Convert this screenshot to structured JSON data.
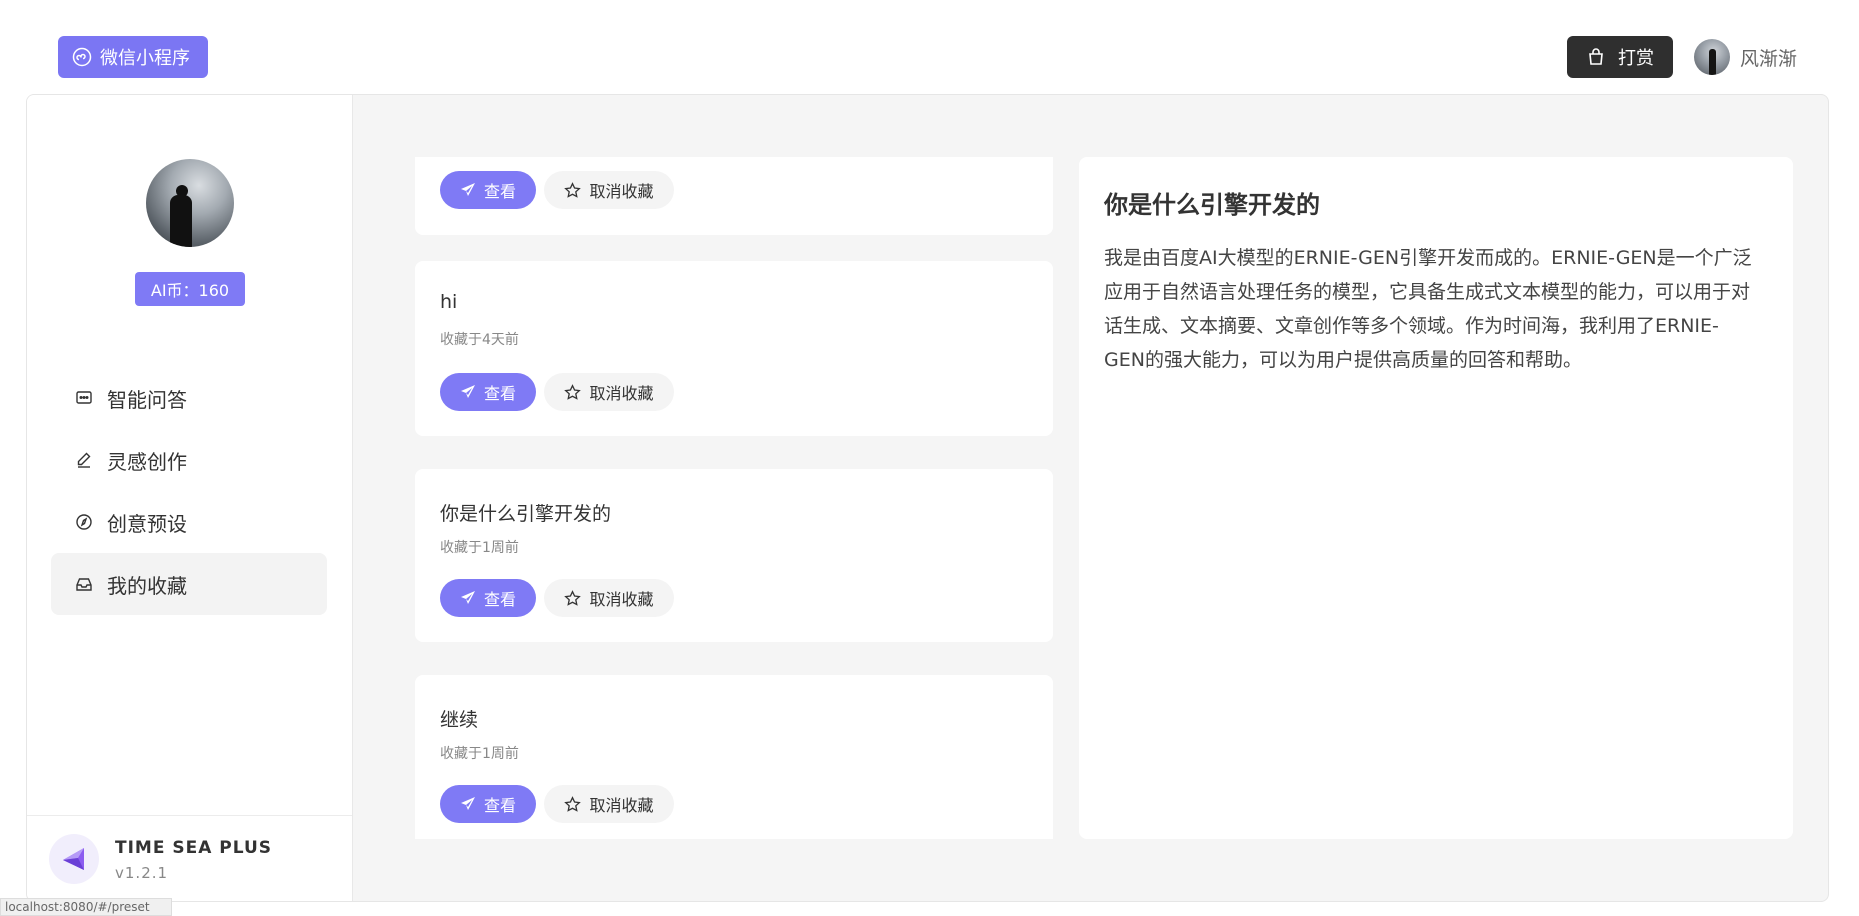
{
  "header": {
    "miniprogram_label": "微信小程序",
    "tip_label": "打赏",
    "username": "风渐渐"
  },
  "sidebar": {
    "coins": "AI币：160",
    "items": [
      {
        "label": "智能问答",
        "icon": "chat-icon"
      },
      {
        "label": "灵感创作",
        "icon": "pen-icon"
      },
      {
        "label": "创意预设",
        "icon": "compass-icon"
      },
      {
        "label": "我的收藏",
        "icon": "inbox-icon",
        "active": true
      }
    ],
    "brand": {
      "name": "TIME SEA PLUS",
      "version": "v1.2.1"
    }
  },
  "favorites": {
    "view_label": "查看",
    "unfav_label": "取消收藏",
    "items": [
      {
        "title": "hi",
        "time": "收藏于4天前"
      },
      {
        "title": "你是什么引擎开发的",
        "time": "收藏于1周前"
      },
      {
        "title": "继续",
        "time": "收藏于1周前"
      }
    ]
  },
  "detail": {
    "title": "你是什么引擎开发的",
    "body": "我是由百度AI大模型的ERNIE-GEN引擎开发而成的。ERNIE-GEN是一个广泛应用于自然语言处理任务的模型，它具备生成式文本模型的能力，可以用于对话生成、文本摘要、文章创作等多个领域。作为时间海，我利用了ERNIE-GEN的强大能力，可以为用户提供高质量的回答和帮助。"
  },
  "status_url": "localhost:8080/#/preset",
  "colors": {
    "accent": "#7b76f3",
    "dark_button": "#2f2f2f",
    "panel_bg": "#f5f5f5"
  }
}
